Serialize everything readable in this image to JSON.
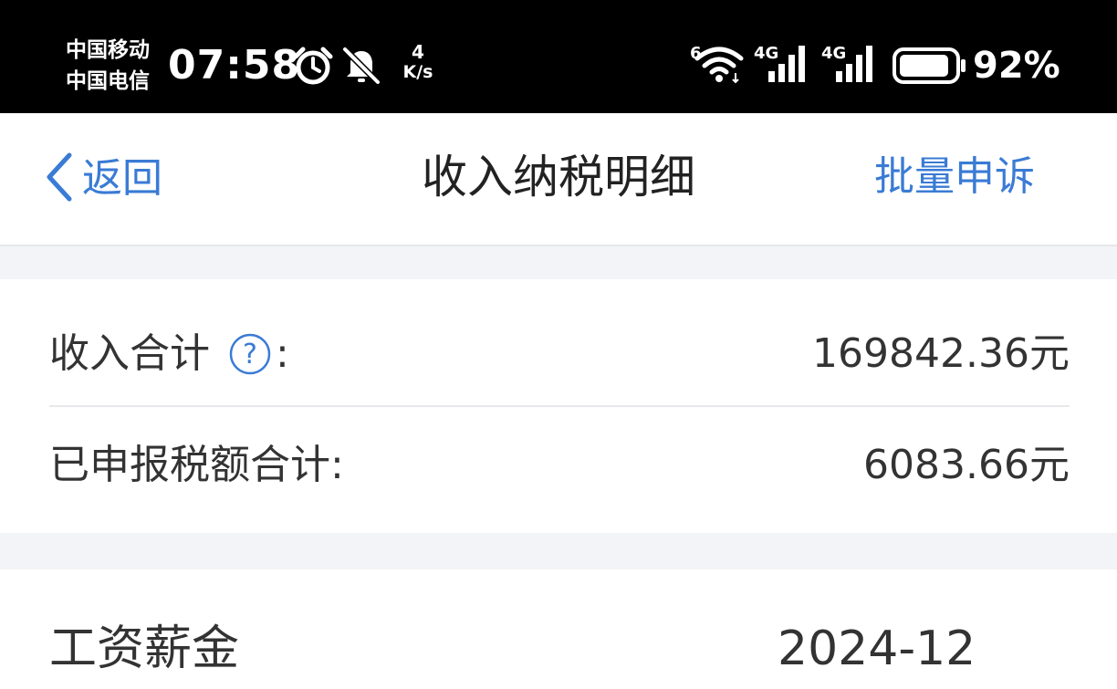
{
  "status_bar": {
    "carrier_1": "中国移动",
    "carrier_2": "中国电信",
    "time": "07:58",
    "net_speed_value": "4",
    "net_speed_unit": "K/s",
    "wifi_label": "6",
    "signal_1_label": "4G",
    "signal_2_label": "4G",
    "battery_percent": "92%",
    "battery_level": 0.92,
    "icons": [
      "alarm-icon",
      "bell-off-icon",
      "wifi-icon",
      "signal-icon",
      "battery-icon"
    ]
  },
  "nav": {
    "back_label": "返回",
    "title": "收入纳税明细",
    "batch_appeal_label": "批量申诉"
  },
  "summary": {
    "income_total_label": "收入合计",
    "income_total_colon": ":",
    "income_total_value": "169842.36元",
    "tax_total_label": "已申报税额合计:",
    "tax_total_value": "6083.66元"
  },
  "records": [
    {
      "type": "工资薪金",
      "period": "2024-12"
    }
  ],
  "colors": {
    "accent": "#3a7bd5",
    "text": "#333333",
    "page_bg": "#f3f4f7",
    "status_bg": "#000000"
  }
}
